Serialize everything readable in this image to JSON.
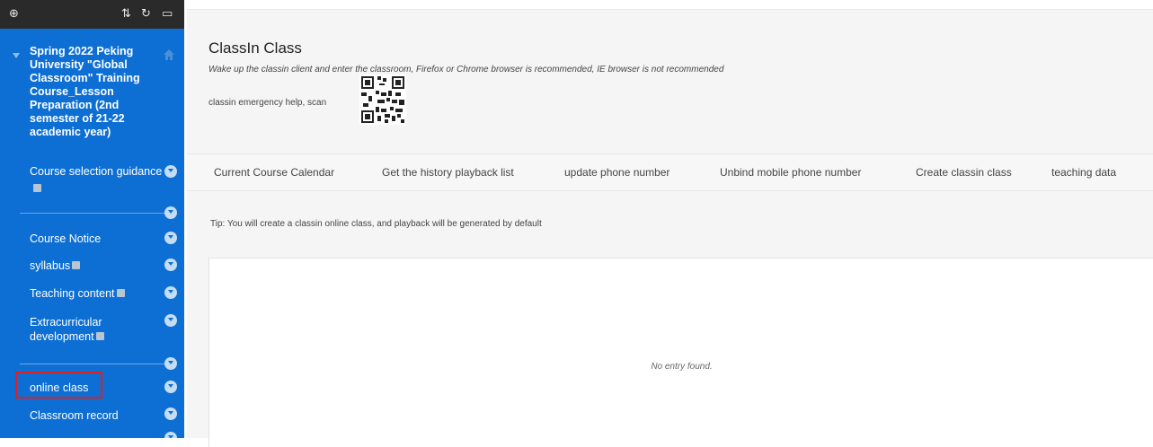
{
  "sidebar": {
    "toolbar_icons": [
      "add-icon",
      "sort-icon",
      "refresh-icon",
      "folder-icon"
    ],
    "course_title": "Spring 2022 Peking University \"Global Classroom\" Training Course_Lesson Preparation (2nd semester of 21-22 academic year)",
    "items": [
      {
        "label": "Course selection guidance"
      },
      {
        "label": "Course Notice"
      },
      {
        "label": "syllabus"
      },
      {
        "label": "Teaching content"
      },
      {
        "label": "Extracurricular development"
      },
      {
        "label": "online class"
      },
      {
        "label": "Classroom record"
      }
    ],
    "brand_color": "#0d6fd3",
    "highlight_color": "#e02020"
  },
  "main": {
    "title": "ClassIn Class",
    "subtitle": "Wake up the classin client and enter the classroom, Firefox or Chrome browser is recommended, IE browser is not recommended",
    "help_text": "classin emergency help, scan",
    "tabs": [
      {
        "label": "Current Course Calendar"
      },
      {
        "label": "Get the history playback list"
      },
      {
        "label": "update phone number"
      },
      {
        "label": "Unbind mobile phone number"
      },
      {
        "label": "Create classin class"
      },
      {
        "label": "teaching data"
      }
    ],
    "tip": "Tip: You will create a classin online class, and playback will be generated by default",
    "empty_message": "No entry found."
  }
}
